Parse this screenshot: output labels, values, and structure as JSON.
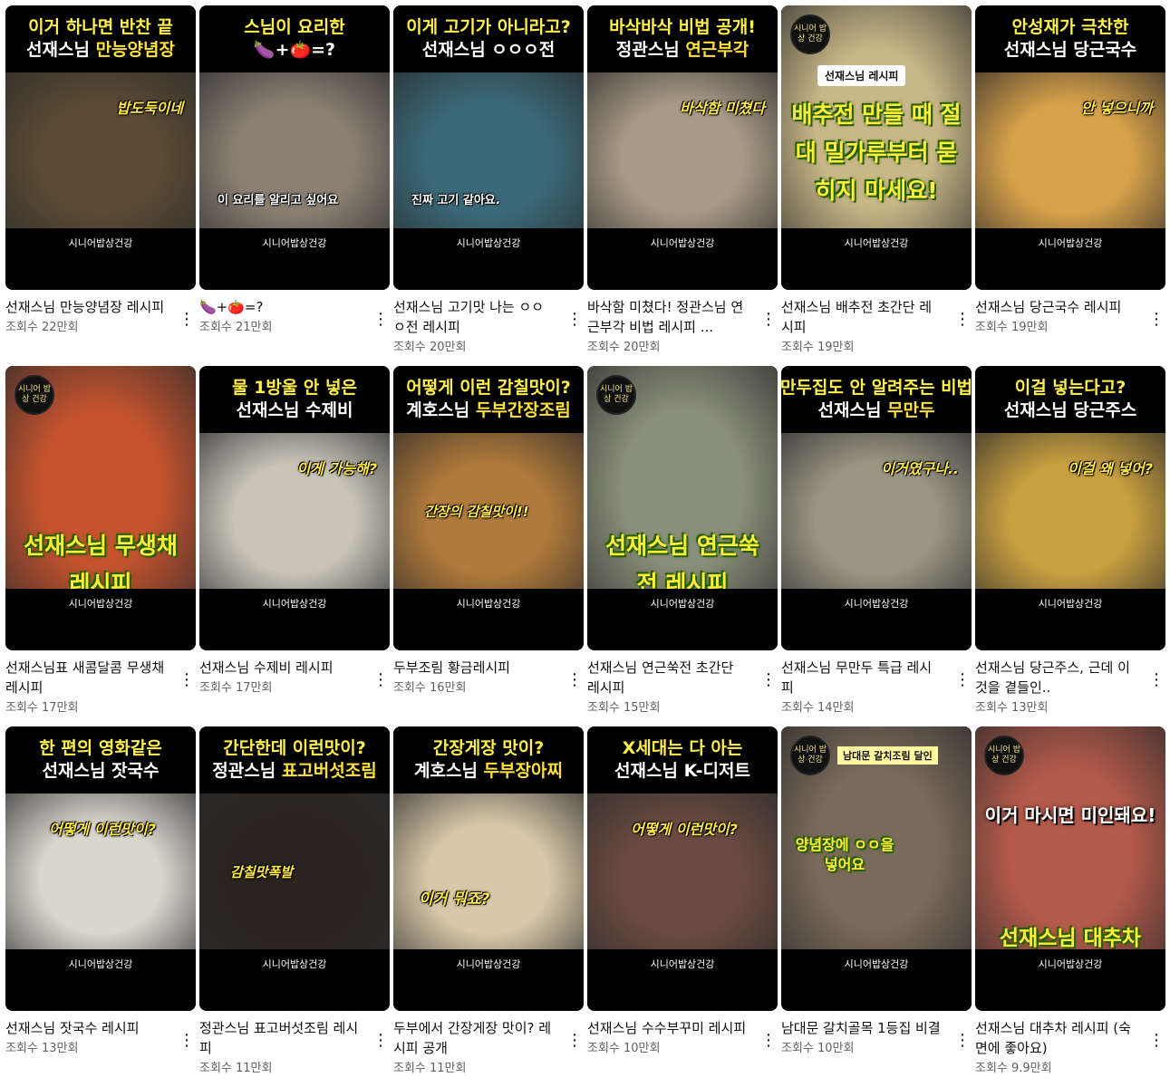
{
  "channel_watermark": "시니어밥상건강",
  "logo_text": "시니어 밥상 건강",
  "more_icon_glyph": "⋮",
  "videos": [
    {
      "line1": "이거 하나면 반찬 끝",
      "line2a": "선재스님 ",
      "line2b": "만능양념장",
      "overlay": "밥도둑이네",
      "title": "선재스님 만능양념장 레시피",
      "views": "조회수 22만회",
      "bg": "#5a4a33"
    },
    {
      "line1": "스님이 요리한",
      "line2a": "🍆+🍅=?",
      "line2b": "",
      "overlay": "이 요리를 알리고 싶어요",
      "title": "🍆+🍅=?",
      "views": "조회수 21만회",
      "bg": "#8a7f72"
    },
    {
      "line1": "이게 고기가 아니라고?",
      "line2a": "선재스님 ㅇㅇㅇ전",
      "line2b": "",
      "overlay": "진짜 고기 같아요.",
      "title": "선재스님 고기맛 나는 ㅇㅇㅇ전 레시피",
      "views": "조회수 20만회",
      "bg": "#3a6a7a"
    },
    {
      "line1": "바삭바삭 비법 공개!",
      "line2a": "정관스님 ",
      "line2b": "연근부각",
      "overlay": "바삭함 미쳤다",
      "title": "바삭함 미쳤다! 정관스님 연근부각 비법 레시피 ...",
      "views": "조회수 20만회",
      "bg": "#a89a84"
    },
    {
      "line1": "",
      "line2a": "",
      "line2b": "",
      "overlay": "배추전 만들 때 절대 밀가루부터 묻히지 마세요!",
      "title": "선재스님 배추전 초간단 레시피",
      "views": "조회수 19만회",
      "bg": "#c9b787"
    },
    {
      "line1": "안성재가 극찬한",
      "line2a": "선재스님 당근국수",
      "line2b": "",
      "overlay": "안 넣으니까",
      "title": "선재스님 당근국수 레시피",
      "views": "조회수 19만회",
      "bg": "#d8a24a"
    },
    {
      "line1": "",
      "line2a": "",
      "line2b": "",
      "overlay": "선재스님 무생채 레시피",
      "title": "선재스님표 새콤달콤 무생채 레시피",
      "views": "조회수 17만회",
      "bg": "#c4532e"
    },
    {
      "line1": "물 1방울 안 넣은",
      "line2a": "선재스님 수제비",
      "line2b": "",
      "overlay": "이게 가능해?",
      "title": "선재스님 수제비 레시피",
      "views": "조회수 17만회",
      "bg": "#c8c4b8"
    },
    {
      "line1": "어떻게 이런 감칠맛이?",
      "line2a": "계호스님 ",
      "line2b": "두부간장조림",
      "overlay": "간장의 감칠맛이!!",
      "title": "두부조림 황금레시피",
      "views": "조회수 16만회",
      "bg": "#b07a3a"
    },
    {
      "line1": "",
      "line2a": "",
      "line2b": "",
      "overlay": "선재스님 연근쑥전 레시피",
      "title": "선재스님 연근쑥전 초간단 레시피",
      "views": "조회수 15만회",
      "bg": "#8a8f7a"
    },
    {
      "line1": "만두집도 안 알려주는 비법",
      "line2a": "선재스님 ",
      "line2b": "무만두",
      "overlay": "이거였구나..",
      "title": "선재스님 무만두 특급 레시피",
      "views": "조회수 14만회",
      "bg": "#9a9684"
    },
    {
      "line1": "이걸 넣는다고?",
      "line2a": "선재스님 당근주스",
      "line2b": "",
      "overlay": "이걸 왜 넣어?",
      "title": "선재스님 당근주스, 근데 이것을 곁들인..",
      "views": "조회수 13만회",
      "bg": "#c9a040"
    },
    {
      "line1": "한 편의 영화같은",
      "line2a": "선재스님 잣국수",
      "line2b": "",
      "overlay": "어떻게 이런맛이?",
      "title": "선재스님 잣국수 레시피",
      "views": "조회수 13만회",
      "bg": "#d9d6cc"
    },
    {
      "line1": "간단한데 이런맛이?",
      "line2a": "정관스님 ",
      "line2b": "표고버섯조림",
      "overlay": "감칠맛폭발",
      "title": "정관스님 표고버섯조림 레시피",
      "views": "조회수 11만회",
      "bg": "#2a2420"
    },
    {
      "line1": "간장게장 맛이?",
      "line2a": "계호스님 ",
      "line2b": "두부장아찌",
      "overlay": "이거 뭐죠?",
      "title": "두부에서 간장게장 맛이? 레시피 공개",
      "views": "조회수 11만회",
      "bg": "#d8c8a8"
    },
    {
      "line1": "X세대는 다 아는",
      "line2a": "선재스님 K-디저트",
      "line2b": "",
      "overlay": "어떻게 이런맛이?",
      "title": "선재스님 수수부꾸미 레시피",
      "views": "조회수 10만회",
      "bg": "#6a4a40"
    },
    {
      "line1": "",
      "line2a": "",
      "line2b": "",
      "overlay": "양념장에 ㅇㅇ을 넣어요",
      "title": "남대문 갈치골목 1등집 비결",
      "views": "조회수 10만회",
      "bg": "#7a6a5a"
    },
    {
      "line1": "",
      "line2a": "",
      "line2b": "",
      "overlay": "이거 마시면 미인돼요!",
      "title": "선재스님 대추차 레시피 (숙면에 좋아요)",
      "views": "조회수 9.9만회",
      "bg": "#b45a4a"
    }
  ],
  "extra_overlays": {
    "v5_label": "선재스님 레시피",
    "v17_label": "남대문 갈치조림 달인",
    "v18_sub": "선재스님 대추차"
  }
}
